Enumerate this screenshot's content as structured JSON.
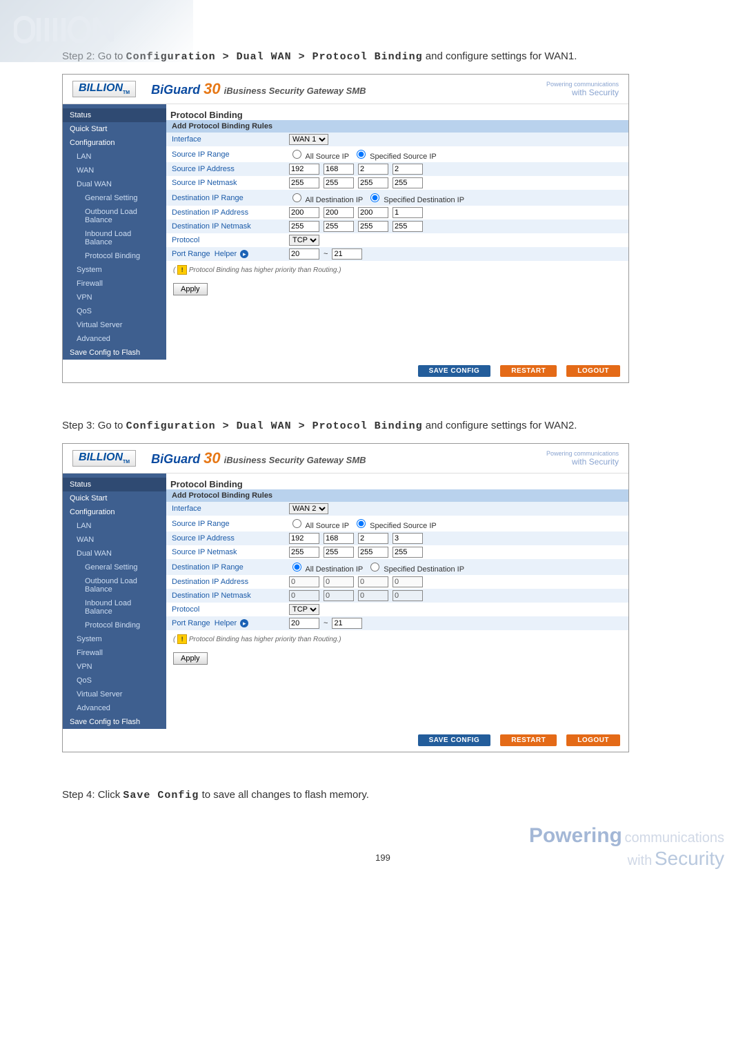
{
  "page": {
    "step2": "Step 2: Go to ",
    "step2_path": "Configuration > Dual WAN > Protocol Binding",
    "step2_tail": " and configure settings for WAN1.",
    "step3": "Step 3: Go to ",
    "step3_path": "Configuration > Dual WAN > Protocol Binding",
    "step3_tail": " and configure settings for WAN2.",
    "step4": "Step 4: Click ",
    "step4_cmd": "Save Config",
    "step4_tail": " to save all changes to flash memory.",
    "pagenum": "199"
  },
  "brand": {
    "logo": "BILLION",
    "logo_tm": "TM",
    "product_bg": "BiGuard",
    "product_num": "30",
    "product_sub": "iBusiness Security Gateway SMB",
    "tag1": "Powering communications",
    "tag2": "with Security"
  },
  "sidebar": {
    "items": [
      "Status",
      "Quick Start",
      "Configuration",
      "LAN",
      "WAN",
      "Dual WAN",
      "General Setting",
      "Outbound Load Balance",
      "Inbound Load Balance",
      "Protocol Binding",
      "System",
      "Firewall",
      "VPN",
      "QoS",
      "Virtual Server",
      "Advanced",
      "Save Config to Flash"
    ]
  },
  "form": {
    "title": "Protocol Binding",
    "section": "Add Protocol Binding Rules",
    "labels": {
      "interface": "Interface",
      "src_range": "Source IP Range",
      "src_addr": "Source IP Address",
      "src_mask": "Source IP Netmask",
      "dst_range": "Destination IP Range",
      "dst_addr": "Destination IP Address",
      "dst_mask": "Destination IP Netmask",
      "protocol": "Protocol",
      "port": "Port Range",
      "helper": "Helper"
    },
    "options": {
      "all_src": "All Source IP",
      "spec_src": "Specified Source IP",
      "all_dst": "All Destination IP",
      "spec_dst": "Specified Destination IP",
      "tcp": "TCP"
    },
    "note": "Protocol Binding has higher priority than Routing.",
    "apply": "Apply"
  },
  "wan1": {
    "iface": "WAN 1",
    "src_addr": [
      "192",
      "168",
      "2",
      "2"
    ],
    "src_mask": [
      "255",
      "255",
      "255",
      "255"
    ],
    "dst_addr": [
      "200",
      "200",
      "200",
      "1"
    ],
    "dst_mask": [
      "255",
      "255",
      "255",
      "255"
    ],
    "port": [
      "20",
      "21"
    ]
  },
  "wan2": {
    "iface": "WAN 2",
    "src_addr": [
      "192",
      "168",
      "2",
      "3"
    ],
    "src_mask": [
      "255",
      "255",
      "255",
      "255"
    ],
    "dst_addr": [
      "0",
      "0",
      "0",
      "0"
    ],
    "dst_mask": [
      "0",
      "0",
      "0",
      "0"
    ],
    "port": [
      "20",
      "21"
    ]
  },
  "footer": {
    "save": "SAVE CONFIG",
    "restart": "RESTART",
    "logout": "LOGOUT"
  },
  "watermark": {
    "p": "Powering",
    "c": "communications",
    "w": "with",
    "s": "Security"
  }
}
